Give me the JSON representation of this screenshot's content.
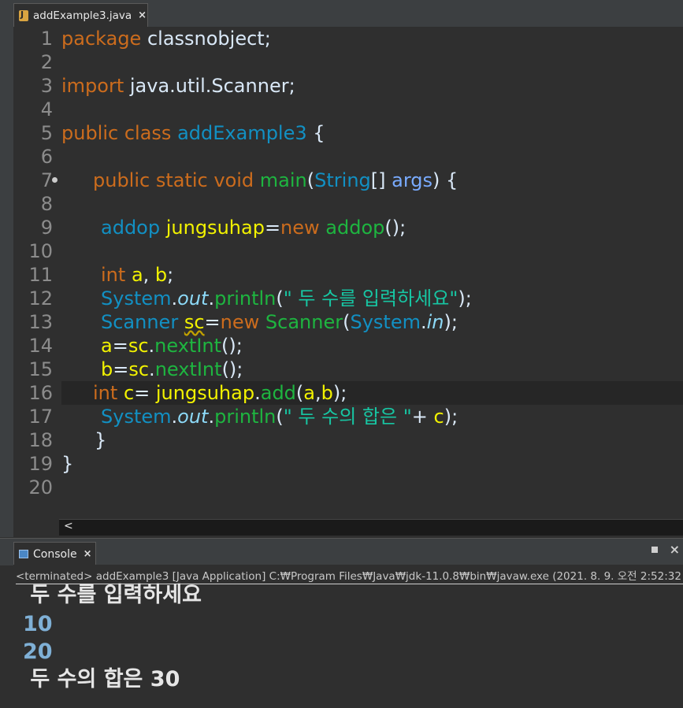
{
  "editor_tab": {
    "title": "addExample3.java",
    "close": "×",
    "icon": "java-file-icon"
  },
  "line_numbers": [
    "1",
    "2",
    "3",
    "4",
    "5",
    "6",
    "7",
    "8",
    "9",
    "10",
    "11",
    "12",
    "13",
    "14",
    "15",
    "16",
    "17",
    "18",
    "19",
    "20"
  ],
  "code": {
    "l1": [
      "package",
      " classnobject;"
    ],
    "l3": [
      "import",
      " java.util.Scanner;"
    ],
    "l5": [
      "public class",
      " ",
      "addExample3",
      " {"
    ],
    "l7": [
      "public static void",
      " ",
      "main",
      "(",
      "String",
      "[] ",
      "args",
      ") {"
    ],
    "l9": [
      "addop",
      " ",
      "jungsuhap",
      "=",
      "new",
      " ",
      "addop",
      "();"
    ],
    "l11": [
      "int",
      " ",
      "a",
      ", ",
      "b",
      ";"
    ],
    "l12": [
      "System",
      ".",
      "out",
      ".",
      "println",
      "(",
      "\" 두 수를 입력하세요\"",
      ");"
    ],
    "l13": [
      "Scanner",
      " ",
      "sc",
      "=",
      "new",
      " ",
      "Scanner",
      "(",
      "System",
      ".",
      "in",
      ");"
    ],
    "l14": [
      "a",
      "=",
      "sc",
      ".",
      "nextInt",
      "();"
    ],
    "l15": [
      "b",
      "=",
      "sc",
      ".",
      "nextInt",
      "();"
    ],
    "l16": [
      "int",
      " ",
      "c",
      "= ",
      "jungsuhap",
      ".",
      "add",
      "(",
      "a",
      ",",
      "b",
      ");"
    ],
    "l17": [
      "System",
      ".",
      "out",
      ".",
      "println",
      "(",
      "\" 두 수의 합은 \"",
      "+ ",
      "c",
      ");"
    ],
    "l18": [
      "}"
    ],
    "l19": [
      "}"
    ]
  },
  "hscroll": {
    "left_arrow": "<"
  },
  "console": {
    "tab_label": "Console",
    "close": "×",
    "status": "<terminated> addExample3 [Java Application] C:₩Program Files₩Java₩jdk-11.0.8₩bin₩javaw.exe  (2021. 8. 9. 오전 2:52:32 –",
    "output": [
      {
        "text": " 두 수를 입력하세요",
        "kind": "out"
      },
      {
        "text": "10",
        "kind": "in"
      },
      {
        "text": "20",
        "kind": "in"
      },
      {
        "text": " 두 수의 합은 30",
        "kind": "out"
      }
    ],
    "close_view": "×"
  },
  "colors": {
    "keyword": "#cc6c1d",
    "class": "#1290c3",
    "method": "#1eb540",
    "variable": "#f2f200",
    "string": "#17c6a3",
    "background": "#2f2f2f"
  }
}
